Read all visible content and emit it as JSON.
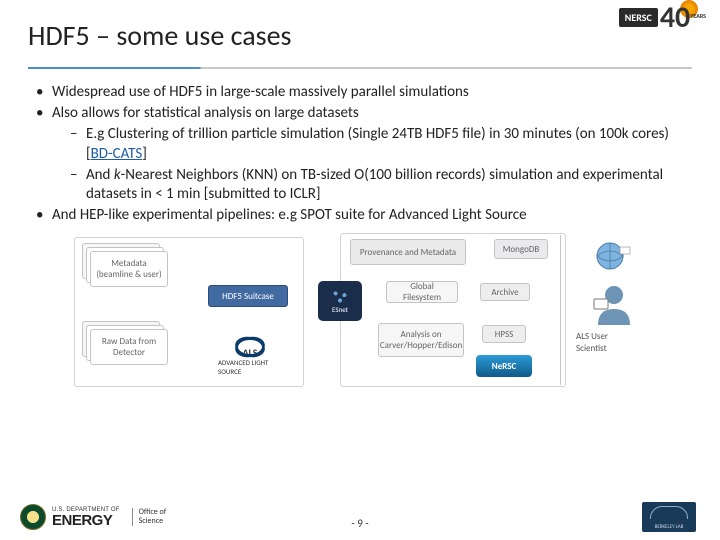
{
  "header": {
    "title": "HDF5 – some use cases",
    "nersc": "NERSC",
    "forty": "40",
    "years": "YEARS"
  },
  "bullets": {
    "b1": "Widespread use of HDF5 in large-scale massively parallel simulations",
    "b2": "Also allows for statistical analysis on large datasets",
    "b2a_pre": "E.g Clustering of trillion particle simulation (Single 24TB HDF5 file) in 30 minutes (on 100k cores) [",
    "b2a_link": "BD-CATS",
    "b2a_post": "]",
    "b2b_pre": "And ",
    "b2b_ital": "k",
    "b2b_post": "-Nearest Neighbors (KNN) on TB-sized O(100 billion records) simulation and experimental datasets in < 1 min [submitted to ICLR]",
    "b3": "And HEP-like experimental pipelines: e.g SPOT suite for Advanced Light Source"
  },
  "diagram": {
    "metadata": "Metadata (beamline & user)",
    "rawdata": "Raw Data from Detector",
    "suitcase": "HDF5 Suitcase",
    "als": "ADVANCED LIGHT SOURCE",
    "esnet": "ESnet",
    "prov": "Provenance and Metadata",
    "mongo": "MongoDB",
    "gfs": "Global Filesystem",
    "archive": "Archive",
    "analysis": "Analysis on Carver/Hopper/Edison",
    "hpss": "HPSS",
    "nersc": "NeRSC",
    "user": "ALS User Scientist"
  },
  "footer": {
    "dept": "U.S. DEPARTMENT OF",
    "energy": "ENERGY",
    "office1": "Office of",
    "office2": "Science",
    "page": "- 9 -",
    "lbnl": "BERKELEY LAB"
  }
}
